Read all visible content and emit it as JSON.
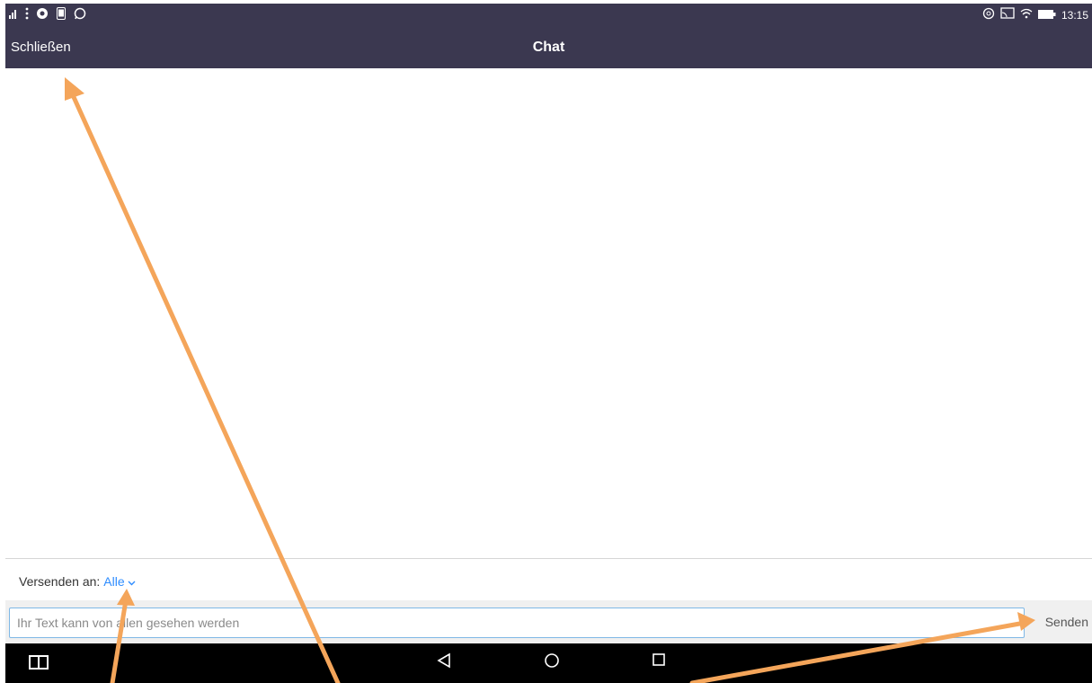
{
  "status_bar": {
    "time": "13:15",
    "left_icons": [
      "signal-icon",
      "more-vert-icon",
      "settings-gear-icon",
      "phone-icon",
      "whatsapp-icon"
    ],
    "right_icons": [
      "copyright-icon",
      "cast-icon",
      "wifi-icon",
      "battery-icon"
    ]
  },
  "header": {
    "close_label": "Schließen",
    "title": "Chat"
  },
  "composer": {
    "send_to_label": "Versenden an:",
    "recipient": "Alle",
    "input_placeholder": "Ihr Text kann von allen gesehen werden",
    "input_value": "",
    "send_label": "Senden"
  },
  "nav_bar": {
    "icons": [
      "multi-window-icon",
      "back-icon",
      "home-icon",
      "recents-icon"
    ]
  },
  "colors": {
    "app_bar": "#3b3850",
    "accent": "#2d8cff",
    "annotation_arrow": "#f4a55a",
    "nav_bar": "#000000"
  }
}
